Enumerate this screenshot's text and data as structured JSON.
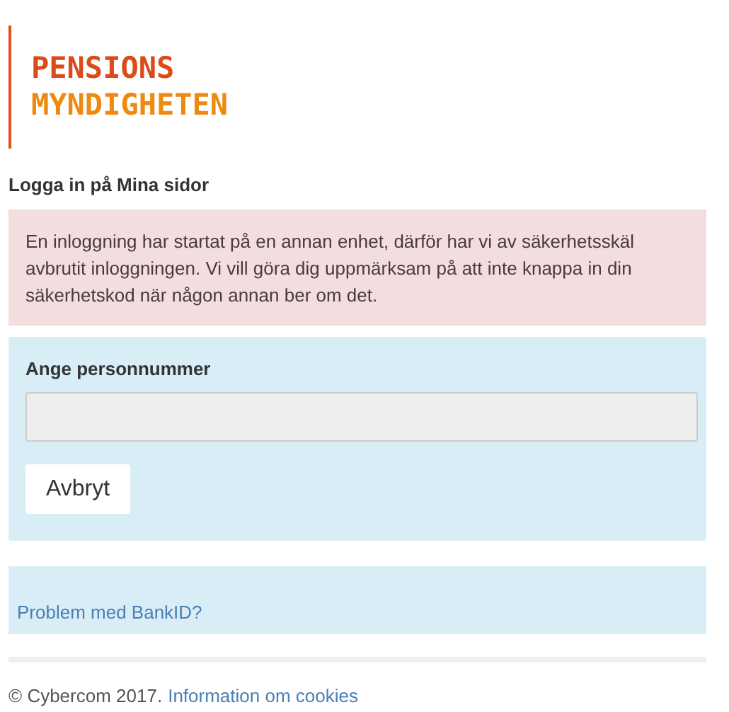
{
  "logo": {
    "line_1": "PENSIONS",
    "line_2": "MYNDIGHETEN"
  },
  "heading": "Logga in på Mina sidor",
  "alert": {
    "text": "En inloggning har startat på en annan enhet, därför har vi av säkerhetsskäl avbrutit inloggningen. Vi vill göra dig uppmärksam på att inte knappa in din säkerhetskod när någon annan ber om det."
  },
  "form": {
    "label": "Ange personnummer",
    "disabled": true,
    "button": "Avbryt"
  },
  "help_link": "Problem med BankID?",
  "footer": {
    "copyright": "© Cybercom 2017.",
    "link": "Information om cookies"
  }
}
